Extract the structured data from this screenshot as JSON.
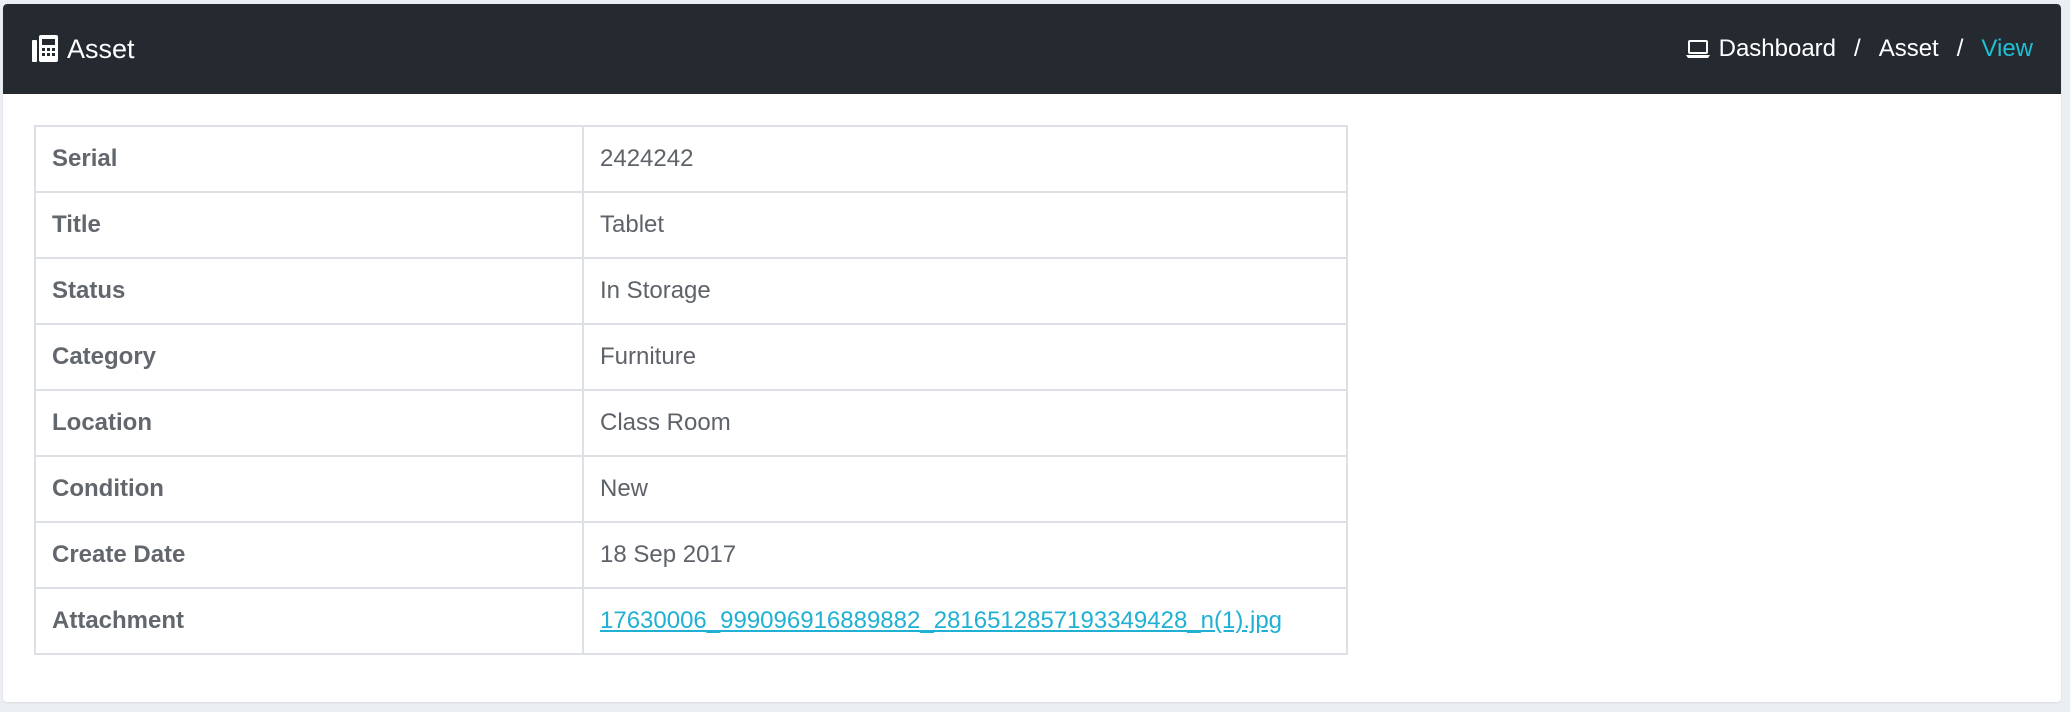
{
  "header": {
    "title": "Asset",
    "title_icon": "asset-icon"
  },
  "breadcrumb": {
    "icon": "laptop-icon",
    "items": [
      "Dashboard",
      "Asset",
      "View"
    ],
    "separator": "/"
  },
  "details": {
    "rows": [
      {
        "label": "Serial",
        "value": "2424242"
      },
      {
        "label": "Title",
        "value": "Tablet"
      },
      {
        "label": "Status",
        "value": "In Storage"
      },
      {
        "label": "Category",
        "value": "Furniture"
      },
      {
        "label": "Location",
        "value": "Class Room"
      },
      {
        "label": "Condition",
        "value": "New"
      },
      {
        "label": "Create Date",
        "value": "18 Sep 2017"
      },
      {
        "label": "Attachment",
        "value": "17630006_999096916889882_2816512857193349428_n(1).jpg"
      }
    ]
  },
  "colors": {
    "header_bg": "#252a31",
    "accent": "#1fc0d4",
    "link": "#1fb0d4"
  }
}
